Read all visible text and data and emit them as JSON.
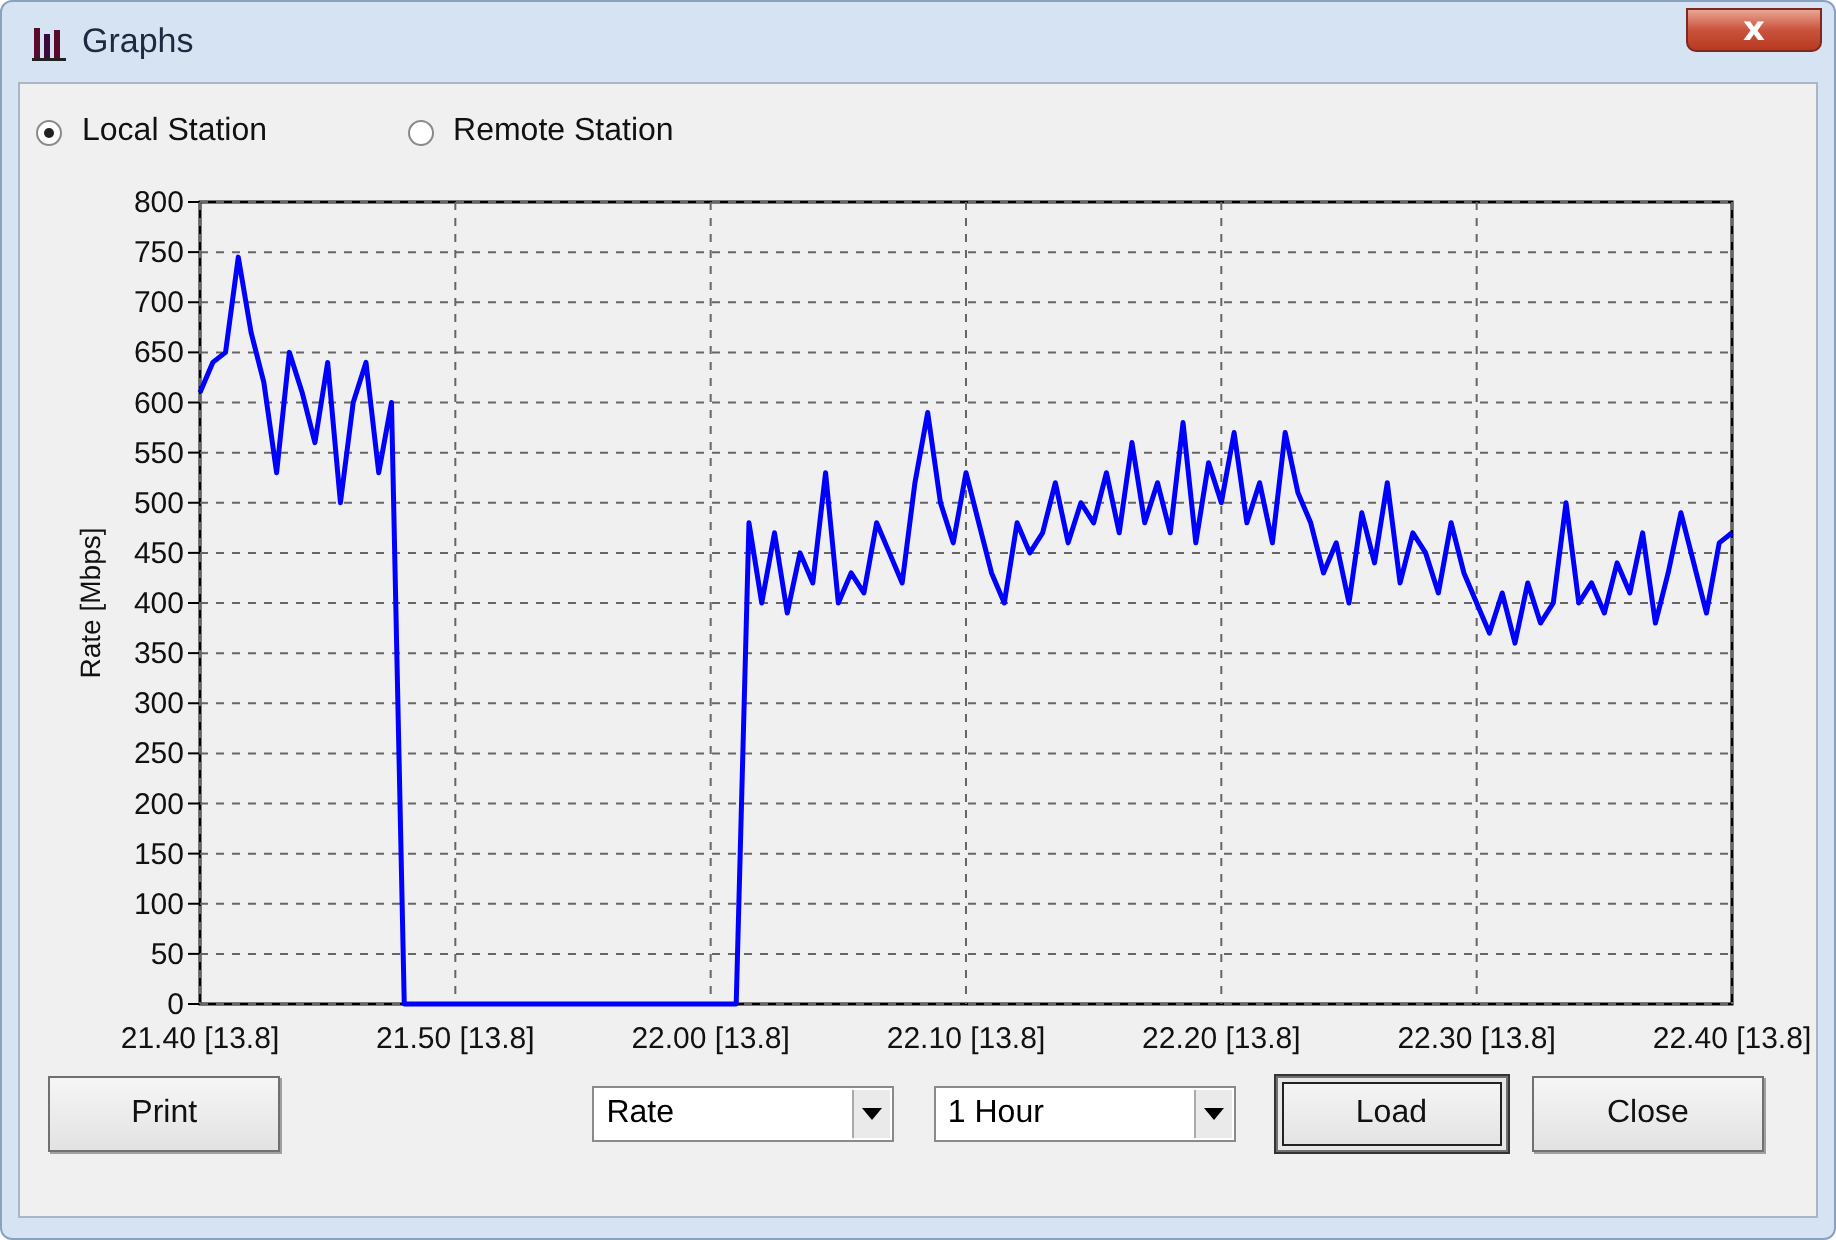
{
  "window": {
    "title": "Graphs",
    "close_glyph": "x"
  },
  "station": [
    {
      "label": "Local Station",
      "selected": true
    },
    {
      "label": "Remote Station",
      "selected": false
    }
  ],
  "chart": {
    "chart_data": {
      "type": "line",
      "grid": true,
      "ylabel": "Rate  [Mbps]",
      "ylim": [
        0,
        800
      ],
      "yticks": [
        0,
        50,
        100,
        150,
        200,
        250,
        300,
        350,
        400,
        450,
        500,
        550,
        600,
        650,
        700,
        750,
        800
      ],
      "categories": [
        "21.40 [13.8]",
        null,
        null,
        null,
        null,
        null,
        null,
        null,
        null,
        null,
        null,
        null,
        null,
        null,
        null,
        null,
        null,
        null,
        null,
        null,
        "21.50 [13.8]",
        null,
        null,
        null,
        null,
        null,
        null,
        null,
        null,
        null,
        null,
        null,
        null,
        null,
        null,
        null,
        null,
        null,
        null,
        null,
        "22.00 [13.8]",
        null,
        null,
        null,
        null,
        null,
        null,
        null,
        null,
        null,
        null,
        null,
        null,
        null,
        null,
        null,
        null,
        null,
        null,
        null,
        "22.10 [13.8]",
        null,
        null,
        null,
        null,
        null,
        null,
        null,
        null,
        null,
        null,
        null,
        null,
        null,
        null,
        null,
        null,
        null,
        null,
        null,
        "22.20 [13.8]",
        null,
        null,
        null,
        null,
        null,
        null,
        null,
        null,
        null,
        null,
        null,
        null,
        null,
        null,
        null,
        null,
        null,
        null,
        null,
        "22.30 [13.8]",
        null,
        null,
        null,
        null,
        null,
        null,
        null,
        null,
        null,
        null,
        null,
        null,
        null,
        null,
        null,
        null,
        null,
        null,
        null,
        "22.40 [13.8]"
      ],
      "series": [
        {
          "color": "#0000ff",
          "values": [
            610,
            640,
            650,
            745,
            670,
            620,
            530,
            650,
            610,
            560,
            640,
            500,
            600,
            640,
            530,
            600,
            0,
            0,
            0,
            0,
            0,
            0,
            0,
            0,
            0,
            0,
            0,
            0,
            0,
            0,
            0,
            0,
            0,
            0,
            0,
            0,
            0,
            0,
            0,
            0,
            0,
            0,
            0,
            480,
            400,
            470,
            390,
            450,
            420,
            530,
            400,
            430,
            410,
            480,
            450,
            420,
            520,
            590,
            500,
            460,
            530,
            480,
            430,
            400,
            480,
            450,
            470,
            520,
            460,
            500,
            480,
            530,
            470,
            560,
            480,
            520,
            470,
            580,
            460,
            540,
            500,
            570,
            480,
            520,
            460,
            570,
            510,
            480,
            430,
            460,
            400,
            490,
            440,
            520,
            420,
            470,
            450,
            410,
            480,
            430,
            400,
            370,
            410,
            360,
            420,
            380,
            400,
            500,
            400,
            420,
            390,
            440,
            410,
            470,
            380,
            430,
            490,
            440,
            390,
            460,
            470
          ]
        }
      ]
    }
  },
  "controls": [
    {
      "kind": "button",
      "label": "Print",
      "focused": false
    },
    {
      "kind": "dropdown",
      "value": "Rate"
    },
    {
      "kind": "dropdown",
      "value": "1 Hour"
    },
    {
      "kind": "button",
      "label": "Load",
      "focused": true
    },
    {
      "kind": "button",
      "label": "Close",
      "focused": false
    }
  ]
}
